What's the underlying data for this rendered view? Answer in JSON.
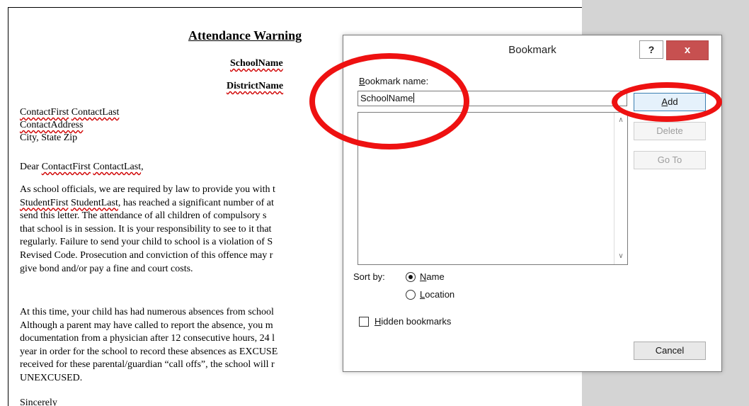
{
  "document": {
    "title": "Attendance Warning",
    "school_field": "SchoolName",
    "district_field": "DistrictName",
    "address_lines": [
      {
        "parts": [
          {
            "t": "ContactFirst",
            "sq": true
          },
          {
            "t": " ",
            "sq": false
          },
          {
            "t": "ContactLast",
            "sq": true
          }
        ]
      },
      {
        "parts": [
          {
            "t": "ContactAddress",
            "sq": true
          }
        ]
      },
      {
        "parts": [
          {
            "t": "City, State  Zip",
            "sq": false
          }
        ]
      }
    ],
    "salutation": {
      "parts": [
        {
          "t": "Dear ",
          "sq": false
        },
        {
          "t": "ContactFirst",
          "sq": true
        },
        {
          "t": " ",
          "sq": false
        },
        {
          "t": "ContactLast",
          "sq": true
        },
        {
          "t": ",",
          "sq": false
        }
      ]
    },
    "paragraph1": [
      {
        "parts": [
          {
            "t": "As school officials, we are required by law to provide you with t",
            "sq": false
          }
        ]
      },
      {
        "parts": [
          {
            "t": "StudentFirst",
            "sq": true
          },
          {
            "t": " ",
            "sq": false
          },
          {
            "t": "StudentLast",
            "sq": true
          },
          {
            "t": ", has reached a significant number of at",
            "sq": false
          }
        ]
      },
      {
        "parts": [
          {
            "t": "send this letter.   The attendance of all children of compulsory s",
            "sq": false
          }
        ]
      },
      {
        "parts": [
          {
            "t": "that school is in session. It is your responsibility to see to it that",
            "sq": false
          }
        ]
      },
      {
        "parts": [
          {
            "t": "regularly. Failure to send your child to school is a violation of S",
            "sq": false
          }
        ]
      },
      {
        "parts": [
          {
            "t": "Revised Code. Prosecution and conviction of this offence may r",
            "sq": false
          }
        ]
      },
      {
        "parts": [
          {
            "t": "give bond and/or pay a fine and court costs.",
            "sq": false
          }
        ]
      }
    ],
    "paragraph2": [
      {
        "parts": [
          {
            "t": "At this time, your child has had numerous absences from school",
            "sq": false
          }
        ]
      },
      {
        "parts": [
          {
            "t": "Although a parent may have called to report the absence, you m",
            "sq": false
          }
        ]
      },
      {
        "parts": [
          {
            "t": "documentation from a physician after 12 consecutive hours, 24 l",
            "sq": false
          }
        ]
      },
      {
        "parts": [
          {
            "t": "year in order for the school to record these absences as EXCUSE",
            "sq": false
          }
        ]
      },
      {
        "parts": [
          {
            "t": "received for these parental/guardian “call offs”, the school will r",
            "sq": false
          }
        ]
      },
      {
        "parts": [
          {
            "t": "UNEXCUSED.",
            "sq": false
          }
        ]
      }
    ],
    "footer_partial": "Sincerely"
  },
  "dialog": {
    "title": "Bookmark",
    "help_label": "?",
    "close_label": "x",
    "name_label_pre": "",
    "name_label_key": "B",
    "name_label_post": "ookmark name:",
    "name_value": "SchoolName",
    "buttons": {
      "add": {
        "pre": "",
        "key": "A",
        "post": "dd"
      },
      "delete": "Delete",
      "goto": "Go To",
      "cancel": "Cancel"
    },
    "sort_label": "Sort by:",
    "sort_options": [
      {
        "pre": "",
        "key": "N",
        "post": "ame",
        "selected": true
      },
      {
        "pre": "",
        "key": "L",
        "post": "ocation",
        "selected": false
      }
    ],
    "hidden_label": {
      "pre": "",
      "key": "H",
      "post": "idden bookmarks"
    },
    "hidden_checked": false
  },
  "colors": {
    "annotation_red": "#ee1111",
    "spellcheck_red": "#d00000",
    "close_button": "#c75050"
  }
}
